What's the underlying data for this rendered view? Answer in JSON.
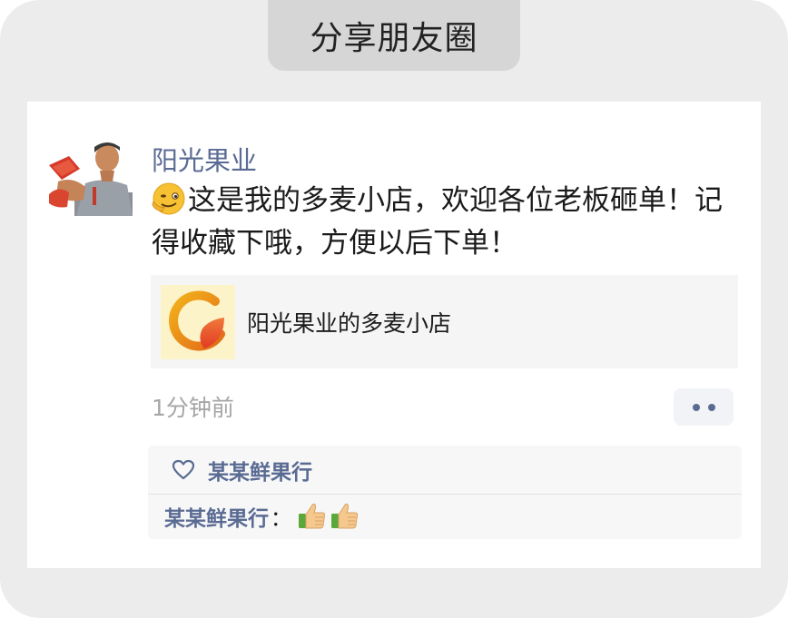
{
  "header": {
    "title": "分享朋友圈"
  },
  "post": {
    "author": "阳光果业",
    "emoji": "wink-face-icon",
    "text": "这是我的多麦小店，欢迎各位老板砸单！记得收藏下哦，方便以后下单！",
    "link_card": {
      "logo": "store-logo-icon",
      "title": "阳光果业的多麦小店"
    },
    "timestamp": "1分钟前",
    "more_button": "more-dots-icon"
  },
  "interactions": {
    "likes": [
      "某某鲜果行"
    ],
    "comments": [
      {
        "author": "某某鲜果行",
        "separator": "：",
        "emojis": [
          "thumbs-up-icon",
          "thumbs-up-icon"
        ]
      }
    ]
  },
  "colors": {
    "frame_bg": "#ececec",
    "tab_bg": "#d6d6d6",
    "name_blue": "#5a6b93",
    "timestamp_gray": "#a6a6a6",
    "card_bg": "#f5f5f5"
  }
}
